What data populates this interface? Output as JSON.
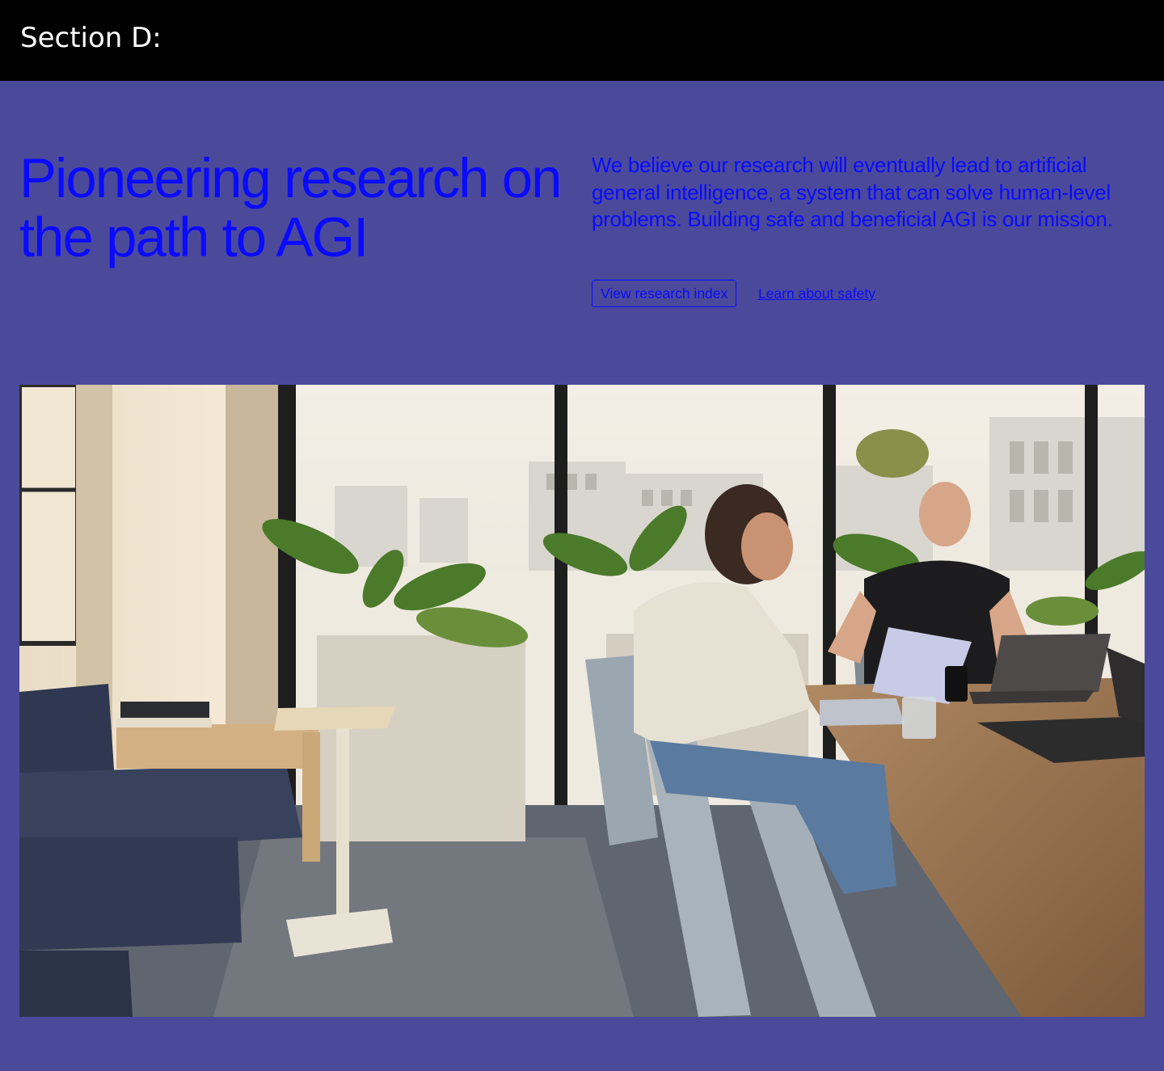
{
  "section": {
    "label": "Section D:"
  },
  "hero": {
    "headline": "Pioneering research on the path to AGI",
    "description": "We believe our research will eventually lead to artificial general intelligence, a system that can solve human-level problems. Building safe and beneficial AGI is our mission.",
    "primary_button_label": "View research index",
    "secondary_link_label": "Learn about safety"
  },
  "colors": {
    "page_background": "#4b4a9a",
    "header_background": "#000000",
    "accent_text": "#0a0aff"
  }
}
